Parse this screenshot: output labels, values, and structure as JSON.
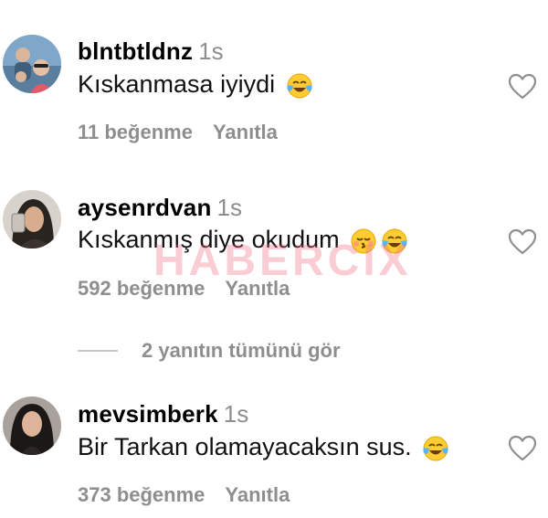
{
  "comments": [
    {
      "username": "blntbtldnz",
      "time": "1s",
      "text": "Kıskanmasa iyiydi",
      "emojis": [
        "tears-of-joy"
      ],
      "likes": "11 beğenme",
      "reply": "Yanıtla"
    },
    {
      "username": "aysenrdvan",
      "time": "1s",
      "text": "Kıskanmış diye okudum",
      "emojis": [
        "kissing-closed-eyes",
        "tears-of-joy"
      ],
      "likes": "592 beğenme",
      "reply": "Yanıtla"
    },
    {
      "username": "mevsimberk",
      "time": "1s",
      "text": "Bir Tarkan olamayacaksın sus.",
      "emojis": [
        "tears-of-joy"
      ],
      "likes": "373 beğenme",
      "reply": "Yanıtla"
    }
  ],
  "view_replies": "2 yanıtın tümünü gör",
  "watermark": "HABERCIX",
  "icons": {
    "like": "heart-outline-icon"
  },
  "colors": {
    "secondary_text": "#8e8e8e",
    "watermark": "#f06e82"
  }
}
